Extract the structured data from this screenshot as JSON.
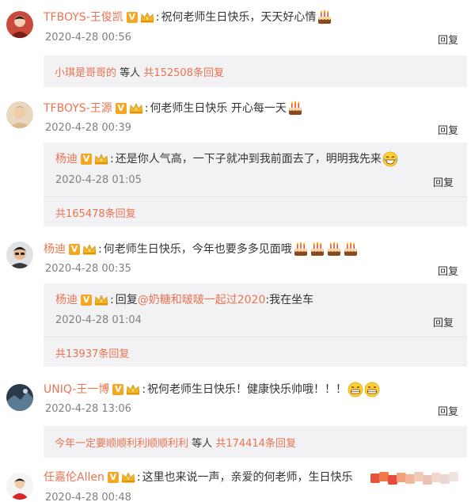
{
  "colors": {
    "accent": "#eb7350",
    "badge": "#f5a623",
    "crown": "#f0b429",
    "reply_bg": "#f2f2f5"
  },
  "reply_label": "回复",
  "comments": [
    {
      "user": "TFBOYS-王俊凯",
      "text": "祝何老师生日快乐，天天好心情",
      "time": "2020-4-28 00:56",
      "summary": {
        "names": "小琪是哥哥的",
        "mid": "等人",
        "count": "共152508条回复"
      }
    },
    {
      "user": "TFBOYS-王源",
      "text": "何老师生日快乐  开心每一天",
      "time": "2020-4-28 00:39",
      "sub": {
        "user": "杨迪",
        "text": "还是你人气高，一下子就冲到我前面去了，明明我先来",
        "time": "2020-4-28 01:05"
      },
      "summary": {
        "count": "共165478条回复"
      }
    },
    {
      "user": "杨迪",
      "text": "何老师生日快乐，今年也要多多见面哦",
      "time": "2020-4-28 00:35",
      "sub": {
        "user": "杨迪",
        "prefix": "回复",
        "mention": "@奶糖和啵啵一起过2020",
        "text": ":我在坐车",
        "time": "2020-4-28 01:04"
      },
      "summary": {
        "count": "共13937条回复"
      }
    },
    {
      "user": "UNIQ-王一博",
      "text": "祝何老师生日快乐！健康快乐帅哦！！！",
      "time": "2020-4-28 13:06",
      "summary": {
        "names": "今年一定要顺顺利利顺顺利利",
        "mid": "等人",
        "count": "共174414条回复"
      }
    },
    {
      "user": "任嘉伦Allen",
      "text": "这里也来说一声，亲爱的何老师，生日快乐",
      "time": "2020-4-28 00:48"
    }
  ]
}
